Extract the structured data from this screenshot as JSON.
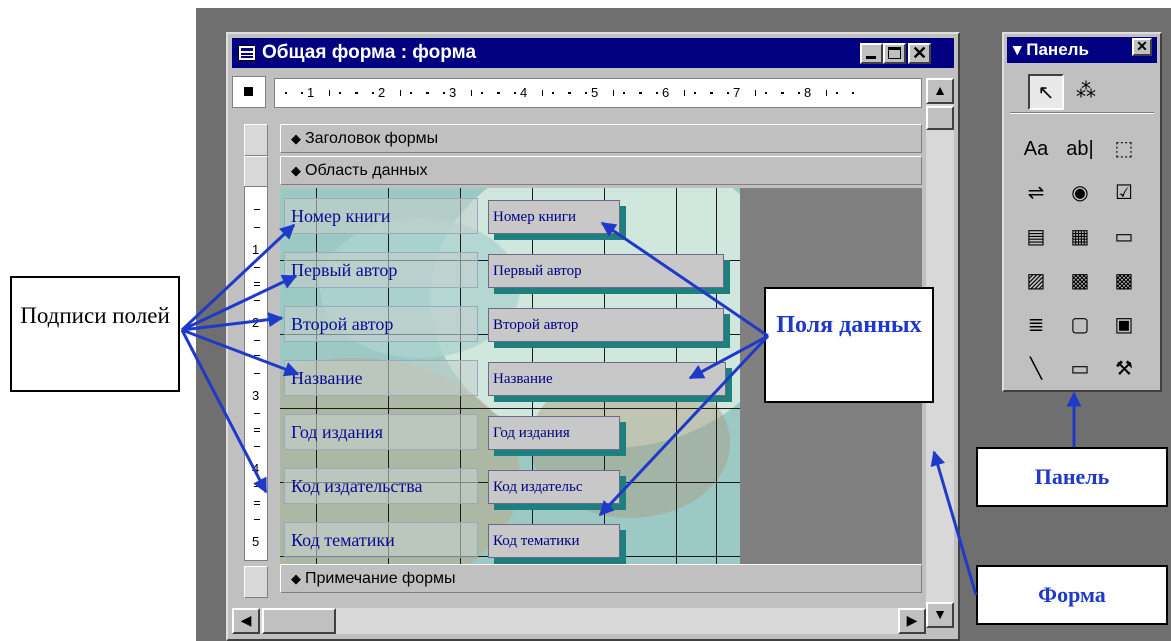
{
  "window": {
    "title": "Общая форма : форма",
    "close_glyph": "✕"
  },
  "ruler": {
    "numbers": [
      "1",
      "2",
      "3",
      "4",
      "5",
      "6",
      "7",
      "8"
    ],
    "vertical_numbers": [
      "1",
      "2",
      "3",
      "4",
      "5"
    ]
  },
  "sections": {
    "header": "Заголовок формы",
    "detail": "Область данных",
    "footer": "Примечание формы",
    "marker_glyph": "◆"
  },
  "fields": [
    {
      "label": "Номер книги",
      "control": "Номер книги"
    },
    {
      "label": "Первый автор",
      "control": "Первый автор"
    },
    {
      "label": "Второй автор",
      "control": "Второй автор"
    },
    {
      "label": "Название",
      "control": "Название"
    },
    {
      "label": "Год издания",
      "control": "Год издания"
    },
    {
      "label": "Код издательства",
      "control": "Код издательс"
    },
    {
      "label": "Код тематики",
      "control": "Код тематики"
    }
  ],
  "toolbox": {
    "title": "▾ Панель",
    "close_glyph": "✕",
    "tools": [
      {
        "name": "select-objects",
        "glyph": "↖"
      },
      {
        "name": "control-wizards",
        "glyph": "⁂"
      },
      {
        "name": "label",
        "glyph": "Aa"
      },
      {
        "name": "text-box",
        "glyph": "ab|"
      },
      {
        "name": "option-group",
        "glyph": "⬚"
      },
      {
        "name": "toggle-button",
        "glyph": "⇌"
      },
      {
        "name": "option-button",
        "glyph": "◉"
      },
      {
        "name": "check-box",
        "glyph": "☑"
      },
      {
        "name": "combo-box",
        "glyph": "▤"
      },
      {
        "name": "list-box",
        "glyph": "▦"
      },
      {
        "name": "command-button",
        "glyph": "▭"
      },
      {
        "name": "image",
        "glyph": "▨"
      },
      {
        "name": "unbound-object-frame",
        "glyph": "▩"
      },
      {
        "name": "bound-object-frame",
        "glyph": "▩"
      },
      {
        "name": "page-break",
        "glyph": "≣"
      },
      {
        "name": "tab-control",
        "glyph": "▢"
      },
      {
        "name": "subform",
        "glyph": "▣"
      },
      {
        "name": "line",
        "glyph": "╲"
      },
      {
        "name": "rectangle",
        "glyph": "▭"
      },
      {
        "name": "more-controls",
        "glyph": "⚒"
      }
    ]
  },
  "callouts": {
    "field_labels": "Подписи полей",
    "data_fields": "Поля данных",
    "panel": "Панель",
    "form": "Форма"
  },
  "colors": {
    "title_bar": "#000080",
    "annotation_blue": "#1f39c8",
    "field_shadow": "#1f7f7f",
    "label_text": "#0a0a90"
  }
}
